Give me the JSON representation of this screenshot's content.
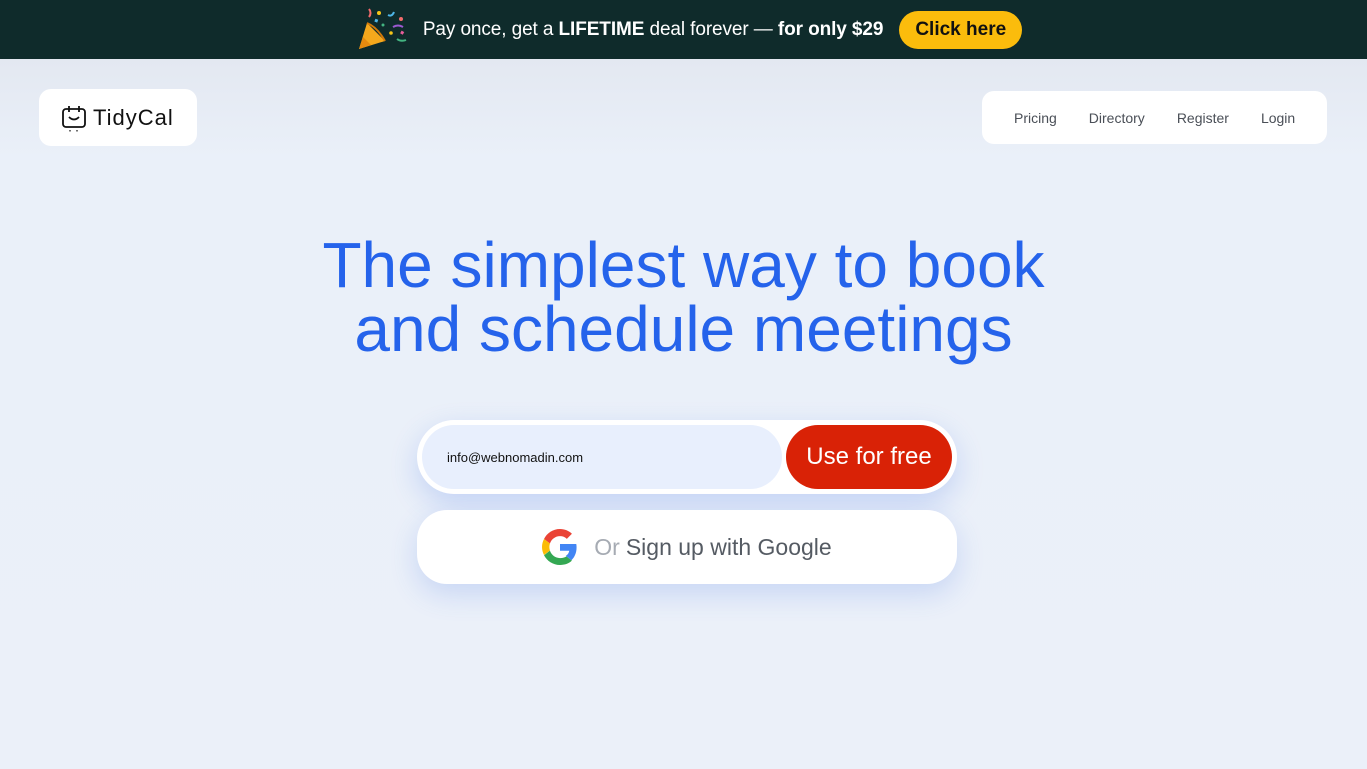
{
  "promo": {
    "text_prefix": "Pay once, get a ",
    "text_bold": "LIFETIME",
    "text_middle": " deal forever — ",
    "text_price": "for only $29",
    "button_label": "Click here",
    "icon": "party-popper-icon"
  },
  "header": {
    "logo_text": "TidyCal",
    "logo_icon": "calendar-icon",
    "nav": [
      {
        "label": "Pricing"
      },
      {
        "label": "Directory"
      },
      {
        "label": "Register"
      },
      {
        "label": "Login"
      }
    ]
  },
  "hero": {
    "headline_line1": "The simplest way to book",
    "headline_line2": "and schedule meetings"
  },
  "signup": {
    "email_value": "info@webnomadin.com",
    "cta_label": "Use for free",
    "google_or": "Or",
    "google_label": "Sign up with Google",
    "google_icon": "google-icon"
  },
  "colors": {
    "promo_bg": "#0f2b2b",
    "promo_button": "#fbbc0c",
    "headline": "#2563eb",
    "cta": "#d92206",
    "page_bg": "#eaf0f9"
  }
}
